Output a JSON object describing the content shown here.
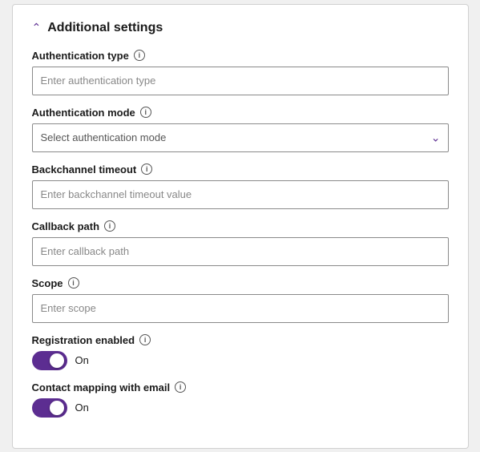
{
  "section": {
    "title": "Additional settings"
  },
  "fields": {
    "authentication_type": {
      "label": "Authentication type",
      "placeholder": "Enter authentication type"
    },
    "authentication_mode": {
      "label": "Authentication mode",
      "placeholder": "Select authentication mode"
    },
    "backchannel_timeout": {
      "label": "Backchannel timeout",
      "placeholder": "Enter backchannel timeout value"
    },
    "callback_path": {
      "label": "Callback path",
      "placeholder": "Enter callback path"
    },
    "scope": {
      "label": "Scope",
      "placeholder": "Enter scope"
    },
    "registration_enabled": {
      "label": "Registration enabled",
      "toggle_label": "On"
    },
    "contact_mapping": {
      "label": "Contact mapping with email",
      "toggle_label": "On"
    }
  }
}
